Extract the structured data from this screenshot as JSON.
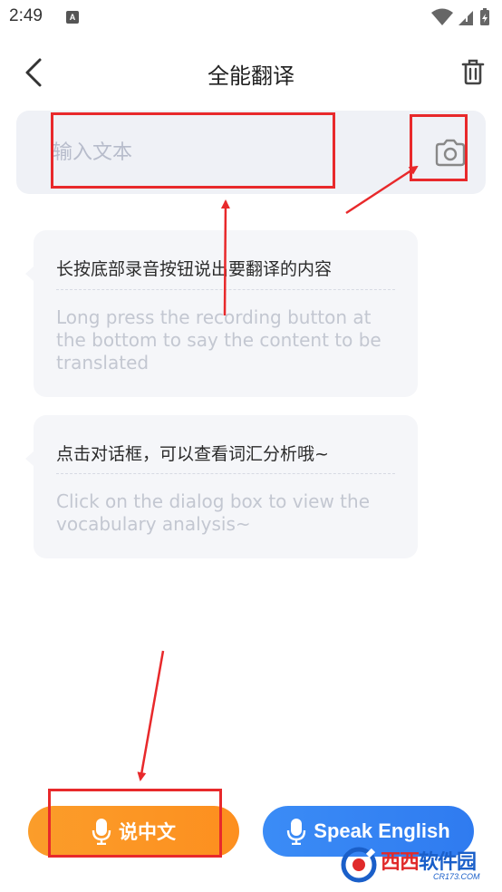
{
  "status_bar": {
    "time": "2:49",
    "notification_glyph": "A"
  },
  "header": {
    "title": "全能翻译"
  },
  "input": {
    "placeholder": "输入文本",
    "value": ""
  },
  "bubbles": [
    {
      "chinese": "长按底部录音按钮说出要翻译的内容",
      "english": "Long press the recording button at the bottom to say the content to be translated"
    },
    {
      "chinese": "点击对话框，可以查看词汇分析哦~",
      "english": "Click on the dialog box to view the vocabulary analysis~"
    }
  ],
  "buttons": {
    "chinese_label": "说中文",
    "english_label": "Speak English"
  },
  "watermark": {
    "main_a": "西西",
    "main_b": "软件园",
    "sub": "CR173.COM"
  },
  "colors": {
    "orange": "#fd8f1f",
    "blue": "#2f7bf0",
    "annotation_red": "#e8292b",
    "bubble_bg": "#f5f6f9",
    "input_bg": "#eff1f6"
  }
}
